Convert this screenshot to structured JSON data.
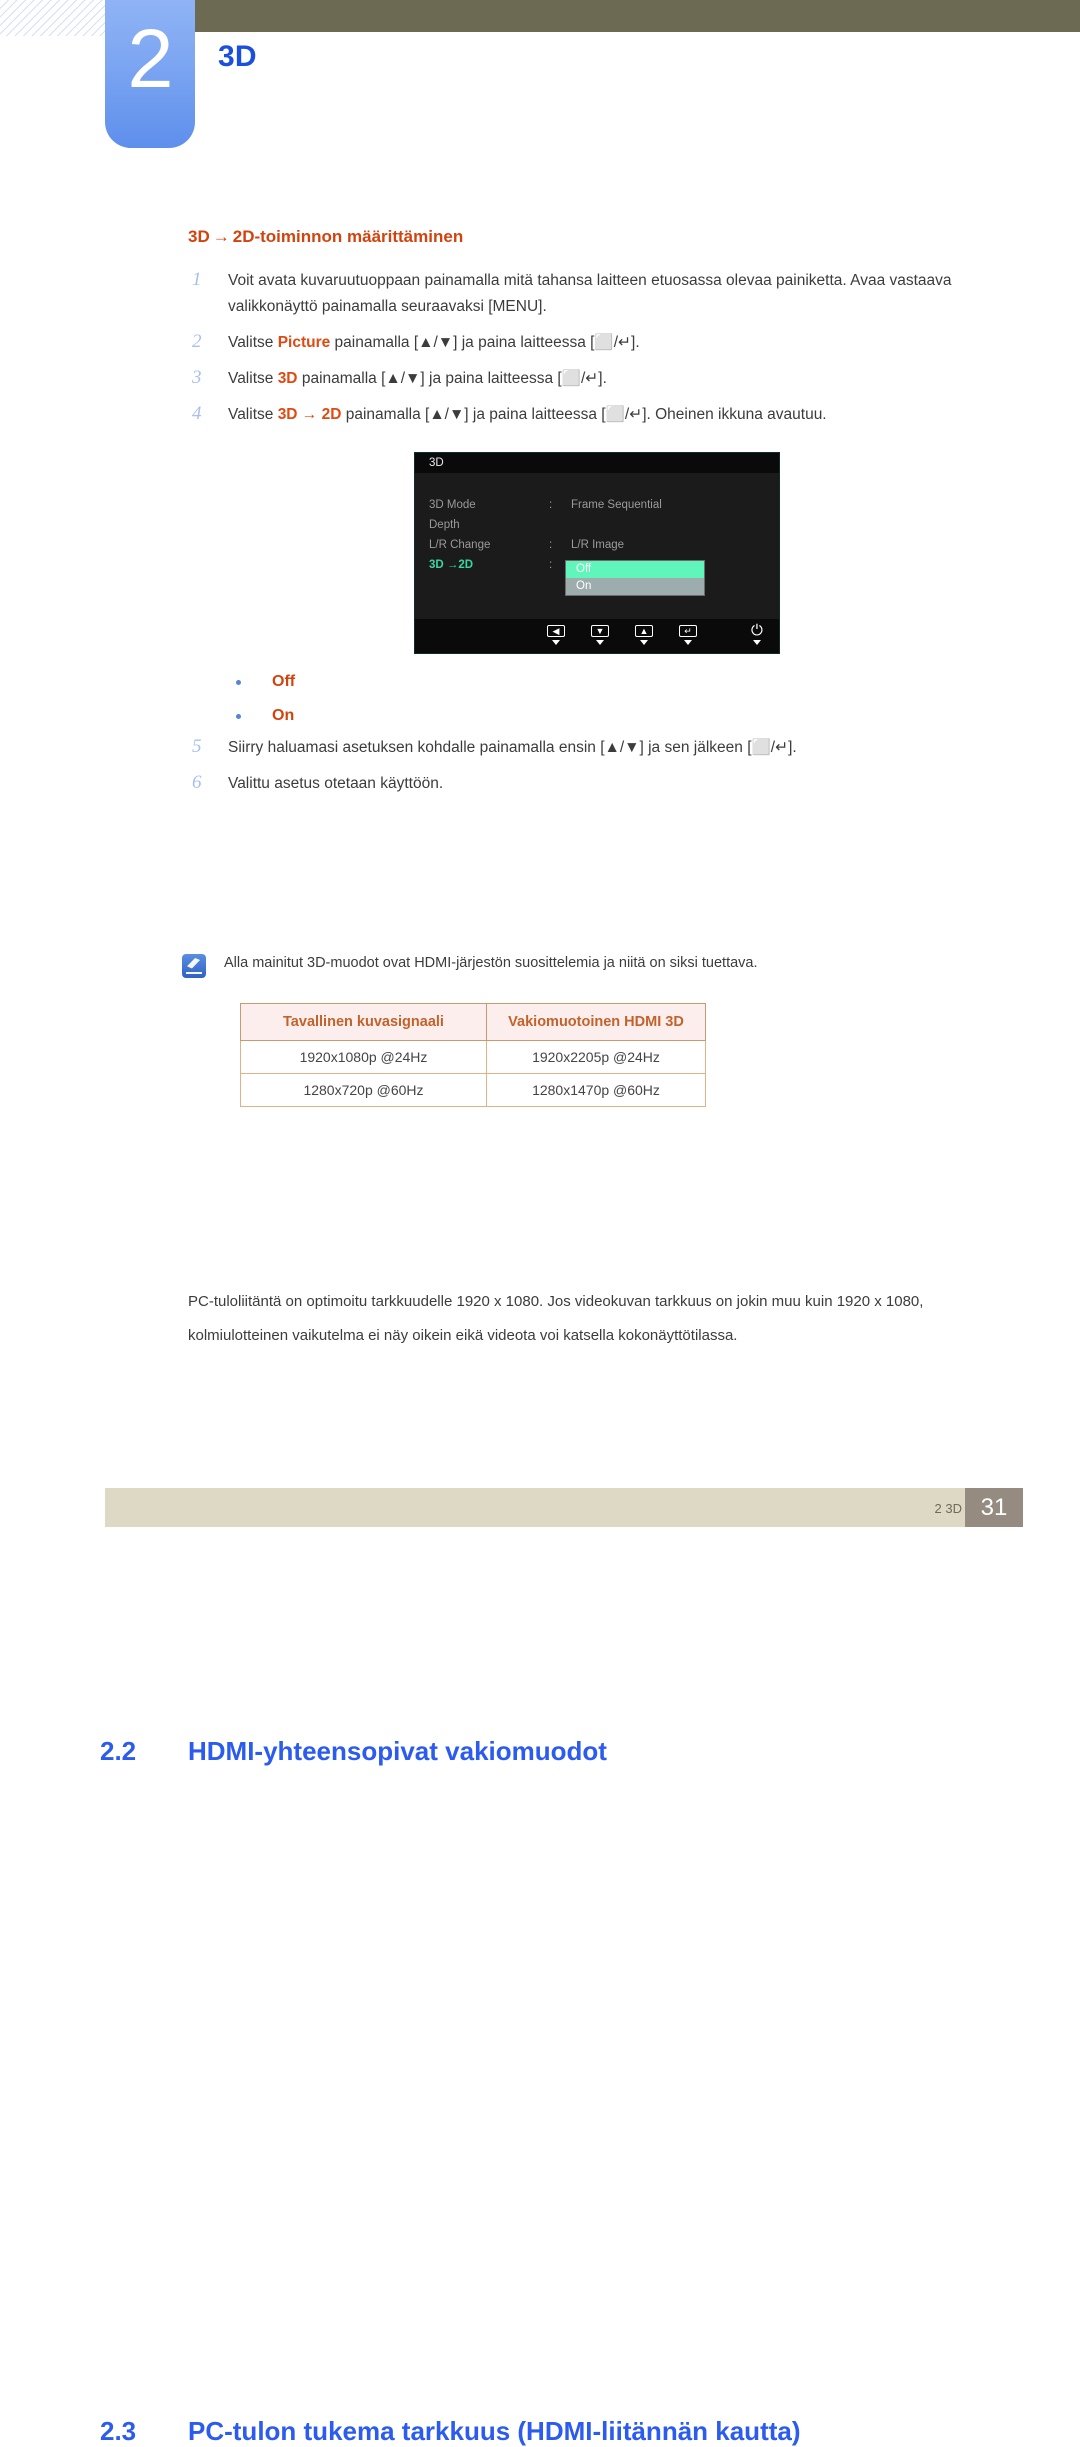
{
  "chapter": {
    "number": "2",
    "title": "3D"
  },
  "subsection": {
    "heading_pre": "3D",
    "heading_arrow": "→",
    "heading_post": "2D-toiminnon määrittäminen"
  },
  "steps": [
    {
      "no": "1",
      "text": "Voit avata kuvaruutuoppaan painamalla mitä tahansa laitteen etuosassa olevaa painiketta. Avaa vastaava valikkonäyttö painamalla seuraavaksi [MENU]."
    },
    {
      "no": "2",
      "prefix": "Valitse ",
      "emphasis": "Picture",
      "suffix": " painamalla [▲/▼] ja paina laitteessa [⬜/↵]."
    },
    {
      "no": "3",
      "prefix": "Valitse ",
      "emphasis": "3D",
      "suffix": " painamalla [▲/▼] ja paina laitteessa [⬜/↵]."
    },
    {
      "no": "4",
      "prefix": "Valitse ",
      "emphasis": "3D → 2D",
      "suffix": " painamalla [▲/▼] ja paina laitteessa [⬜/↵]. Oheinen ikkuna avautuu."
    }
  ],
  "steps_after": [
    {
      "no": "5",
      "text": "Siirry haluamasi asetuksen kohdalle painamalla ensin [▲/▼] ja sen jälkeen [⬜/↵]."
    },
    {
      "no": "6",
      "text": "Valittu asetus otetaan käyttöön."
    }
  ],
  "osd": {
    "title": "3D",
    "rows": [
      {
        "label": "3D Mode",
        "colon": ":",
        "value": "Frame Sequential"
      },
      {
        "label": "Depth",
        "colon": "",
        "value": ""
      },
      {
        "label": "L/R Change",
        "colon": ":",
        "value": "L/R Image"
      },
      {
        "label": "3D →2D",
        "colon": ":",
        "value": ""
      }
    ],
    "dropdown": {
      "selected": "Off",
      "unselected": "On"
    },
    "buttons": [
      "left-arrow",
      "down-arrow",
      "up-arrow",
      "enter",
      "power"
    ]
  },
  "option_bullets": [
    "Off",
    "On"
  ],
  "section22": {
    "number": "2.2",
    "title": "HDMI-yhteensopivat vakiomuodot",
    "note": "Alla mainitut 3D-muodot ovat HDMI-järjestön suosittelemia ja niitä on siksi tuettava.",
    "table": {
      "headers": [
        "Tavallinen kuvasignaali",
        "Vakiomuotoinen HDMI 3D"
      ],
      "rows": [
        [
          "1920x1080p @24Hz",
          "1920x2205p @24Hz"
        ],
        [
          "1280x720p @60Hz",
          "1280x1470p @60Hz"
        ]
      ]
    }
  },
  "section23": {
    "number": "2.3",
    "title": "PC-tulon tukema tarkkuus (HDMI-liitännän kautta)",
    "paragraph": "PC-tuloliitäntä on optimoitu tarkkuudelle 1920 x 1080. Jos videokuvan tarkkuus on jokin muu kuin 1920 x 1080, kolmiulotteinen vaikutelma ei näy oikein eikä videota voi katsella kokonäyttötilassa."
  },
  "footer": {
    "label": "2 3D",
    "page": "31"
  },
  "colors": {
    "chapter_blue": "#2b5bef",
    "accent_orange": "#d2430e",
    "olive": "#6d6a54",
    "footer_bg": "#ded9c5",
    "page_box": "#958b80",
    "osd_green": "#5ff5bb"
  }
}
